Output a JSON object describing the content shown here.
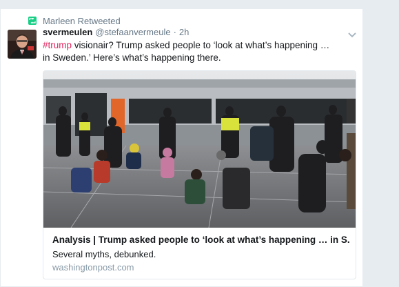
{
  "retweet": {
    "text": "Marleen Retweeted",
    "icon": "retweet-icon",
    "color": "#19cf86"
  },
  "author": {
    "name": "svermeulen",
    "handle": "@stefaanvermeule",
    "separator": "·",
    "time": "2h"
  },
  "tweet": {
    "hashtag": "#trump",
    "text": " visionair? Trump asked people to ‘look at what’s happening … in Sweden.’ Here’s what’s happening there."
  },
  "link_card": {
    "title": "Analysis | Trump asked people to ‘look at what’s happening … in S...",
    "description": "Several myths, debunked.",
    "domain": "washingtonpost.com"
  },
  "colors": {
    "hashtag": "#e0245e",
    "secondary_text": "#657786",
    "background": "#e6ecf0"
  }
}
